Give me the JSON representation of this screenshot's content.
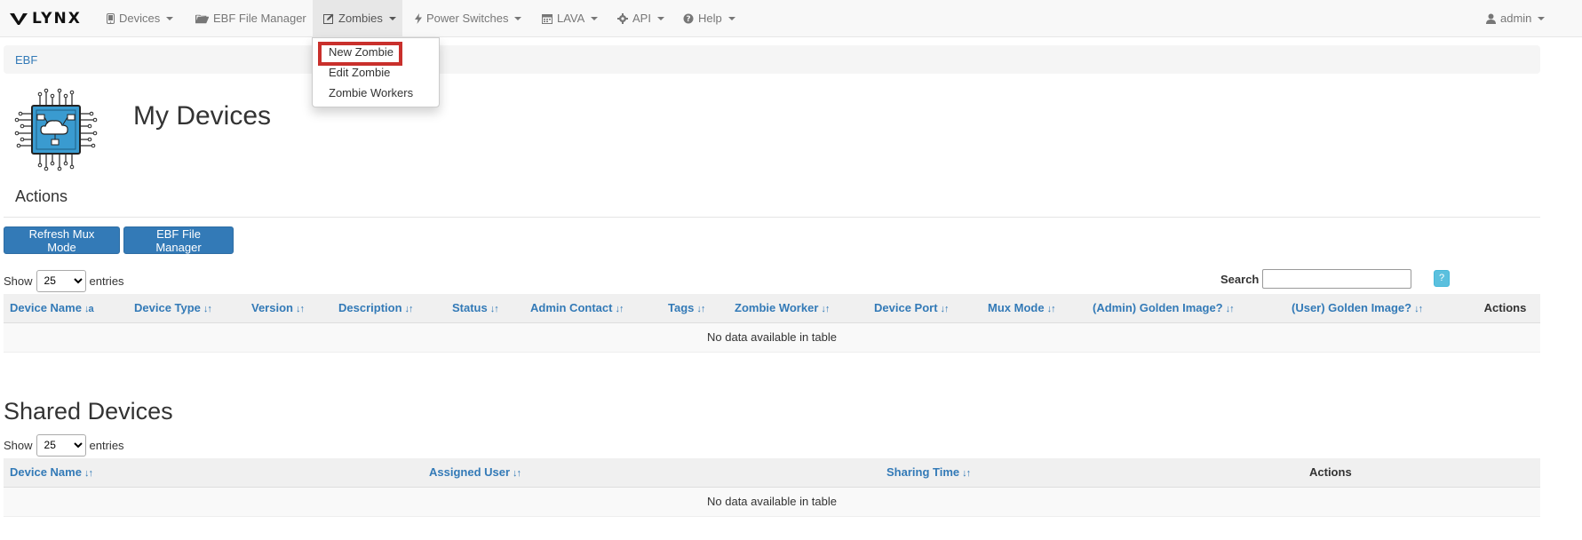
{
  "navbar": {
    "brand": "LYNX",
    "items": [
      {
        "label": "Devices",
        "icon": "mobile-icon"
      },
      {
        "label": "EBF File Manager",
        "icon": "folder-open-icon"
      },
      {
        "label": "Zombies",
        "icon": "edit-square-icon"
      },
      {
        "label": "Power Switches",
        "icon": "flash-icon"
      },
      {
        "label": "LAVA",
        "icon": "calendar-icon"
      },
      {
        "label": "API",
        "icon": "cog-icon"
      },
      {
        "label": "Help",
        "icon": "question-circle-icon"
      }
    ],
    "user": "admin"
  },
  "zombies_menu": {
    "items": [
      "New Zombie",
      "Edit Zombie",
      "Zombie Workers"
    ],
    "highlighted": "New Zombie"
  },
  "breadcrumb": [
    "EBF"
  ],
  "page": {
    "title": "My Devices",
    "actions_title": "Actions",
    "buttons": [
      "Refresh Mux Mode",
      "EBF File Manager"
    ]
  },
  "my_devices_table": {
    "show_label": "Show",
    "entries_label": "entries",
    "page_length": "25",
    "search_label": "Search",
    "search_value": "",
    "help_label": "?",
    "columns": [
      "Device Name",
      "Device Type",
      "Version",
      "Description",
      "Status",
      "Admin Contact",
      "Tags",
      "Zombie Worker",
      "Device Port",
      "Mux Mode",
      "(Admin) Golden Image?",
      "(User) Golden Image?",
      "Actions"
    ],
    "empty_message": "No data available in table"
  },
  "shared_devices": {
    "title": "Shared Devices",
    "show_label": "Show",
    "entries_label": "entries",
    "page_length": "25",
    "columns": [
      "Device Name",
      "Assigned User",
      "Sharing Time",
      "Actions"
    ],
    "empty_message": "No data available in table"
  },
  "colors": {
    "primary": "#337ab7",
    "info": "#5bc0de",
    "highlight": "#c9302c",
    "chip": "#3a9bd0"
  }
}
